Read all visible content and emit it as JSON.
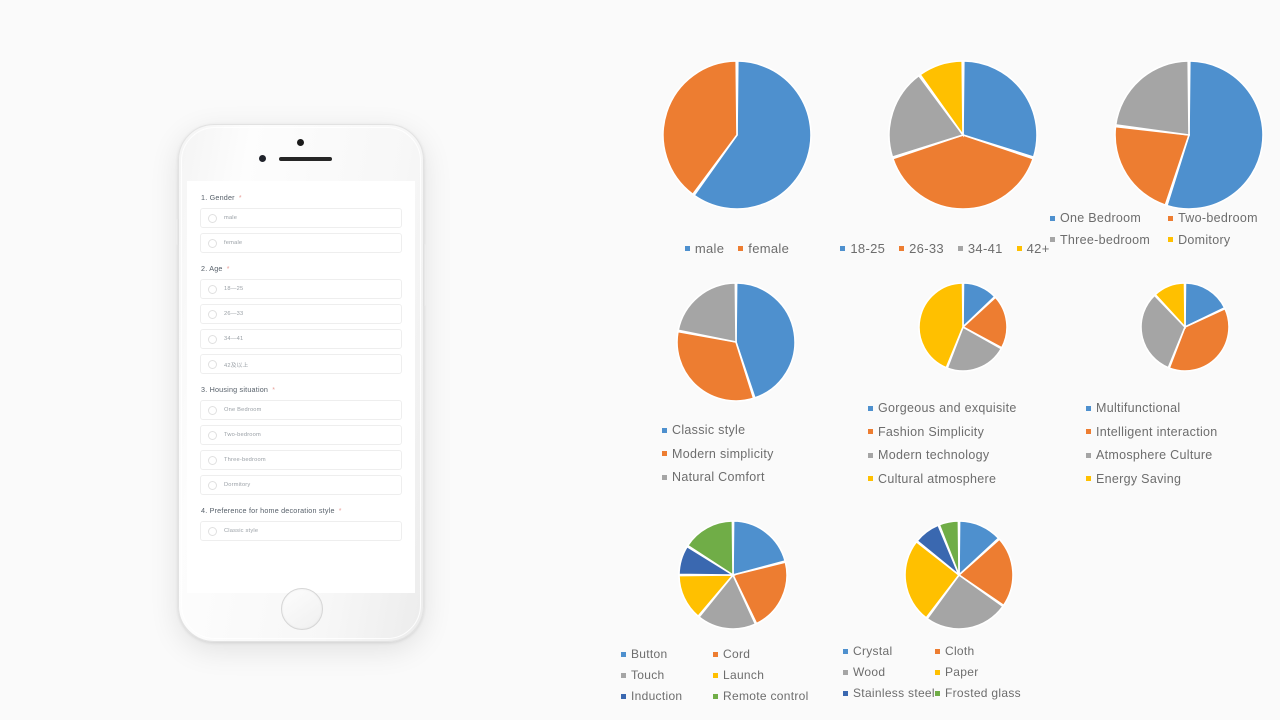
{
  "palette": {
    "blue": "#4E90CE",
    "orange": "#ED7D31",
    "gray": "#A5A5A5",
    "yellow": "#FFC000",
    "darkblue": "#3A68B0",
    "green": "#70AD47",
    "background": "#FAFAFA",
    "legend_text": "#6D6D6D"
  },
  "phone": {
    "form": {
      "questions": [
        {
          "number": "1.",
          "title": "Gender",
          "required": "*",
          "options": [
            "male",
            "female"
          ]
        },
        {
          "number": "2.",
          "title": "Age",
          "required": "*",
          "options": [
            "18—25",
            "26—33",
            "34—41",
            "42及以上"
          ]
        },
        {
          "number": "3.",
          "title": "Housing situation",
          "required": "*",
          "options": [
            "One Bedroom",
            "Two-bedroom",
            "Three-bedroom",
            "Dormitory"
          ]
        },
        {
          "number": "4.",
          "title": "Preference for home decoration style",
          "required": "*",
          "options": [
            "Classic style"
          ]
        }
      ]
    }
  },
  "chart_data": [
    {
      "type": "pie",
      "title": "Gender",
      "legend_position": "bottom",
      "labels": [
        "male",
        "female"
      ],
      "values": [
        60,
        40
      ],
      "colors": [
        "#4E90CE",
        "#ED7D31"
      ]
    },
    {
      "type": "pie",
      "title": "Age",
      "legend_position": "bottom",
      "labels": [
        "18-25",
        "26-33",
        "34-41",
        "42+"
      ],
      "values": [
        30,
        40,
        20,
        10
      ],
      "colors": [
        "#4E90CE",
        "#ED7D31",
        "#A5A5A5",
        "#FFC000"
      ]
    },
    {
      "type": "pie",
      "title": "Housing situation",
      "legend_position": "bottom",
      "labels": [
        "One Bedroom",
        "Two-bedroom",
        "Three-bedroom",
        "Domitory"
      ],
      "values": [
        55,
        22,
        23,
        0
      ],
      "colors": [
        "#4E90CE",
        "#ED7D31",
        "#A5A5A5",
        "#FFC000"
      ]
    },
    {
      "type": "pie",
      "title": "Preference for home decoration style",
      "legend_position": "bottom",
      "labels": [
        "Classic style",
        "Modern simplicity",
        "Natural Comfort"
      ],
      "values": [
        45,
        33,
        22
      ],
      "colors": [
        "#4E90CE",
        "#ED7D31",
        "#A5A5A5"
      ]
    },
    {
      "type": "pie",
      "title": "Lamp style",
      "legend_position": "bottom",
      "labels": [
        "Gorgeous and exquisite",
        "Fashion Simplicity",
        "Modern technology",
        "Cultural atmosphere"
      ],
      "values": [
        13,
        20,
        23,
        44
      ],
      "colors": [
        "#4E90CE",
        "#ED7D31",
        "#A5A5A5",
        "#FFC000"
      ]
    },
    {
      "type": "pie",
      "title": "Lamp function",
      "legend_position": "bottom",
      "labels": [
        "Multifunctional",
        "Intelligent interaction",
        "Atmosphere Culture",
        "Energy Saving"
      ],
      "values": [
        18,
        38,
        32,
        12
      ],
      "colors": [
        "#4E90CE",
        "#ED7D31",
        "#A5A5A5",
        "#FFC000"
      ]
    },
    {
      "type": "pie",
      "title": "Control method",
      "legend_position": "bottom",
      "labels": [
        "Button",
        "Cord",
        "Touch",
        "Launch",
        "Induction",
        "Remote control"
      ],
      "values": [
        21,
        22,
        18,
        14,
        9,
        16
      ],
      "colors": [
        "#4E90CE",
        "#ED7D31",
        "#A5A5A5",
        "#FFC000",
        "#3A68B0",
        "#70AD47"
      ]
    },
    {
      "type": "pie",
      "title": "Material",
      "legend_position": "bottom",
      "labels": [
        "Crystal",
        "Cloth",
        "Wood",
        "Paper",
        "Stainless steel",
        "Frosted glass"
      ],
      "values": [
        13,
        21,
        25,
        25,
        8,
        6
      ],
      "colors": [
        "#4E90CE",
        "#ED7D31",
        "#A5A5A5",
        "#FFC000",
        "#3A68B0",
        "#70AD47"
      ]
    }
  ]
}
